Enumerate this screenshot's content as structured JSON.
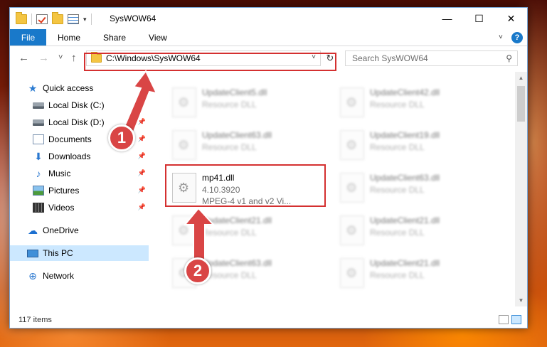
{
  "window": {
    "title": "SysWOW64",
    "minimize_icon": "—",
    "maximize_icon": "☐",
    "close_icon": "✕"
  },
  "ribbon": {
    "tabs": [
      "File",
      "Home",
      "Share",
      "View"
    ],
    "help_icon": "?"
  },
  "navbar": {
    "back_icon": "←",
    "forward_icon": "→",
    "recent_icon": "˅",
    "up_icon": "↑",
    "address": "C:\\Windows\\SysWOW64",
    "refresh_icon": "↻",
    "search_placeholder": "Search SysWOW64",
    "search_icon": "⚲"
  },
  "sidebar": {
    "items": [
      {
        "label": "Quick access",
        "icon": "star-icon",
        "glyph": "★"
      },
      {
        "label": "Local Disk (C:)",
        "icon": "disk-icon",
        "pinned": true
      },
      {
        "label": "Local Disk (D:)",
        "icon": "disk-icon",
        "pinned": true
      },
      {
        "label": "Documents",
        "icon": "documents-icon",
        "pinned": true
      },
      {
        "label": "Downloads",
        "icon": "downloads-icon",
        "glyph": "⬇",
        "pinned": true
      },
      {
        "label": "Music",
        "icon": "music-icon",
        "glyph": "♪",
        "pinned": true
      },
      {
        "label": "Pictures",
        "icon": "pictures-icon",
        "pinned": true
      },
      {
        "label": "Videos",
        "icon": "videos-icon",
        "pinned": true
      },
      {
        "label": "OneDrive",
        "icon": "cloud-icon",
        "glyph": "☁"
      },
      {
        "label": "This PC",
        "icon": "computer-icon",
        "selected": true
      },
      {
        "label": "Network",
        "icon": "network-icon",
        "glyph": "⊕"
      }
    ],
    "pin_glyph": "📌"
  },
  "files": [
    {
      "name": "UpdateClient5.dll",
      "type": "Resource DLL",
      "blurred": true
    },
    {
      "name": "UpdateClient42.dll",
      "type": "Resource DLL",
      "blurred": true
    },
    {
      "name": "UpdateClient63.dll",
      "type": "Resource DLL",
      "blurred": true
    },
    {
      "name": "UpdateClient19.dll",
      "type": "Resource DLL",
      "blurred": true
    },
    {
      "name": "mp41.dll",
      "version": "4.10.3920",
      "description": "MPEG-4 v1 and v2 Vi...",
      "blurred": false
    },
    {
      "name": "UpdateClient63.dll",
      "type": "Resource DLL",
      "blurred": true
    },
    {
      "name": "UpdateClient21.dll",
      "type": "Resource DLL",
      "blurred": true
    },
    {
      "name": "UpdateClient21.dll",
      "type": "Resource DLL",
      "blurred": true
    },
    {
      "name": "UpdateClient63.dll",
      "type": "Resource DLL",
      "blurred": true
    },
    {
      "name": "UpdateClient21.dll",
      "type": "Resource DLL",
      "blurred": true
    }
  ],
  "status": {
    "item_count": "117 items"
  },
  "annotations": {
    "badge1": "1",
    "badge2": "2",
    "highlight_color": "#d43030"
  }
}
